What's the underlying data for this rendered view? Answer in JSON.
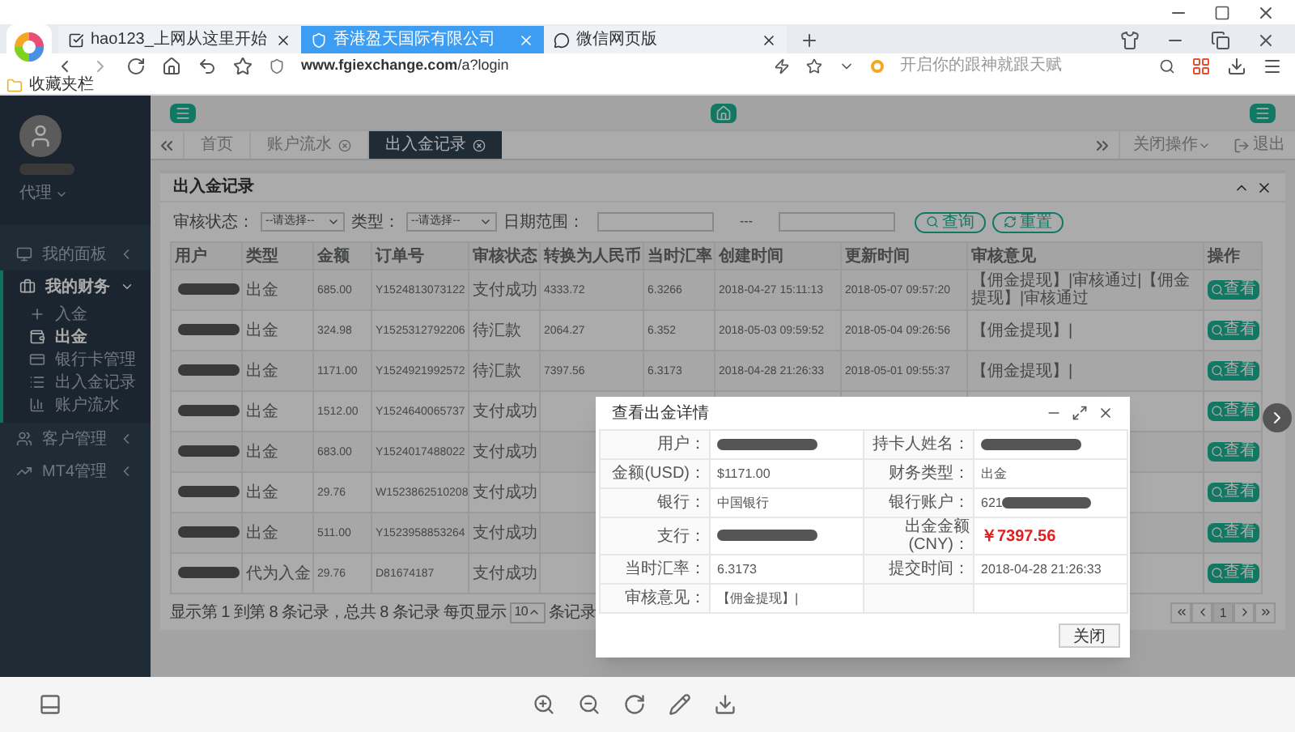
{
  "browser": {
    "tabs": [
      {
        "title": "hao123_上网从这里开始",
        "selected": false
      },
      {
        "title": "香港盈天国际有限公司",
        "selected": true
      },
      {
        "title": "微信网页版",
        "selected": false
      }
    ],
    "url_host": "www.fgiexchange.com",
    "url_path": "/a?login",
    "search_placeholder": "开启你的跟神就跟天赋",
    "bookmark": "收藏夹栏"
  },
  "sidebar": {
    "role": "代理",
    "menu": [
      {
        "label": "我的面板",
        "expanded": false
      },
      {
        "label": "我的财务",
        "expanded": true,
        "children": [
          {
            "label": "入金",
            "selected": false
          },
          {
            "label": "出金",
            "selected": true
          },
          {
            "label": "银行卡管理",
            "selected": false
          },
          {
            "label": "出入金记录",
            "selected": false
          },
          {
            "label": "账户流水",
            "selected": false
          }
        ]
      },
      {
        "label": "客户管理",
        "expanded": false
      },
      {
        "label": "MT4管理",
        "expanded": false
      }
    ]
  },
  "page_tabs": [
    {
      "label": "首页",
      "closable": false,
      "selected": false
    },
    {
      "label": "账户流水",
      "closable": true,
      "selected": false
    },
    {
      "label": "出入金记录",
      "closable": true,
      "selected": true
    }
  ],
  "close_ops": "关闭操作",
  "logout": "退出",
  "panel": {
    "title": "出入金记录",
    "filters": {
      "status_label": "审核状态：",
      "status_value": "--请选择--",
      "type_label": "类型：",
      "type_value": "--请选择--",
      "date_label": "日期范围：",
      "date_sep": "---",
      "search": "查询",
      "reset": "重置"
    },
    "columns": [
      "用户",
      "类型",
      "金额",
      "订单号",
      "审核状态",
      "转换为人民币",
      "当时汇率",
      "创建时间",
      "更新时间",
      "审核意见",
      "操作"
    ],
    "rows": [
      {
        "type": "出金",
        "amount": "685.00",
        "order_no": "Y1524813073122",
        "status": "支付成功",
        "cny": "4333.72",
        "rate": "6.3266",
        "created": "2018-04-27 15:11:13",
        "updated": "2018-05-07 09:57:20",
        "remark": "【佣金提现】|审核通过|【佣金提现】|审核通过",
        "action": "查看"
      },
      {
        "type": "出金",
        "amount": "324.98",
        "order_no": "Y1525312792206",
        "status": "待汇款",
        "cny": "2064.27",
        "rate": "6.352",
        "created": "2018-05-03 09:59:52",
        "updated": "2018-05-04 09:26:56",
        "remark": "【佣金提现】|",
        "action": "查看"
      },
      {
        "type": "出金",
        "amount": "1171.00",
        "order_no": "Y1524921992572",
        "status": "待汇款",
        "cny": "7397.56",
        "rate": "6.3173",
        "created": "2018-04-28 21:26:33",
        "updated": "2018-05-01 09:55:37",
        "remark": "【佣金提现】|",
        "action": "查看"
      },
      {
        "type": "出金",
        "amount": "1512.00",
        "order_no": "Y1524640065737",
        "status": "支付成功",
        "action": "查看"
      },
      {
        "type": "出金",
        "amount": "683.00",
        "order_no": "Y1524017488022",
        "status": "支付成功",
        "action": "查看"
      },
      {
        "type": "出金",
        "amount": "29.76",
        "order_no": "W1523862510208",
        "status": "支付成功",
        "action": "查看"
      },
      {
        "type": "出金",
        "amount": "511.00",
        "order_no": "Y1523958853264",
        "status": "支付成功",
        "action": "查看"
      },
      {
        "type": "代为入金",
        "amount": "29.76",
        "order_no": "D81674187",
        "status": "支付成功",
        "action": "查看"
      }
    ],
    "footer_text": "显示第 1 到第 8 条记录，总共 8 条记录 每页显示",
    "page_size": "10",
    "footer_suffix": "条记录",
    "pages": [
      {
        "label": "1",
        "selected": true
      }
    ]
  },
  "modal": {
    "title": "查看出金详情",
    "rows": [
      [
        {
          "label": "用户：",
          "blurred": true
        },
        {
          "label": "持卡人姓名：",
          "blurred": true
        }
      ],
      [
        {
          "label": "金额(USD)：",
          "value": "$1171.00",
          "blurred": false,
          "highlight": false
        },
        {
          "label": "财务类型：",
          "value": "出金",
          "blurred": false,
          "highlight": false
        }
      ],
      [
        {
          "label": "银行：",
          "value": "中国银行",
          "blurred": false,
          "highlight": false
        },
        {
          "label": "银行账户：",
          "value": "621",
          "blurred": true,
          "highlight": false
        }
      ],
      [
        {
          "label": "支行：",
          "blurred": true
        },
        {
          "label": "出金金额(CNY)：",
          "value": "￥7397.56",
          "blurred": false,
          "highlight": true
        }
      ],
      [
        {
          "label": "当时汇率：",
          "value": "6.3173",
          "blurred": false,
          "highlight": false
        },
        {
          "label": "提交时间：",
          "value": "2018-04-28 21:26:33",
          "blurred": false,
          "highlight": false
        }
      ],
      [
        {
          "label": "审核意见：",
          "value": "【佣金提现】|",
          "blurred": false,
          "highlight": false
        },
        {
          "blurred": false
        }
      ]
    ],
    "close": "关闭"
  }
}
